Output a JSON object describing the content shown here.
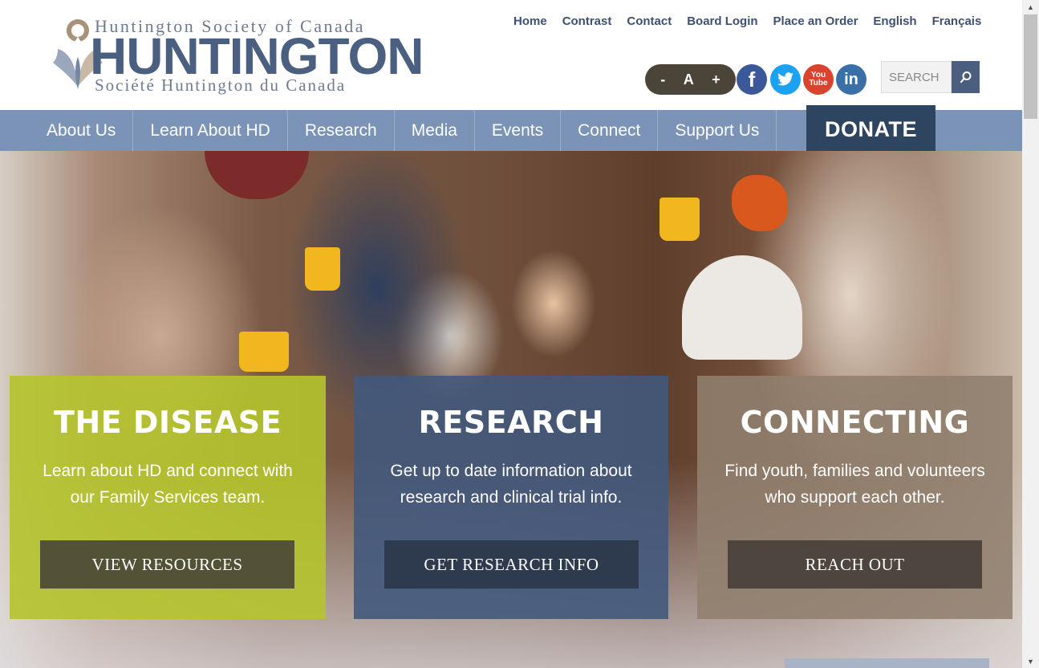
{
  "logo": {
    "top_line": "Huntington Society of Canada",
    "main": "HUNTINGTON",
    "bottom_line": "Société Huntington du Canada"
  },
  "toplinks": [
    "Home",
    "Contrast",
    "Contact",
    "Board Login",
    "Place an Order",
    "English",
    "Français"
  ],
  "font_sizer": {
    "decrease": "-",
    "reset": "A",
    "increase": "+"
  },
  "social": {
    "facebook": "f",
    "twitter": "t",
    "youtube_top": "You",
    "youtube_bottom": "Tube",
    "linkedin": "in"
  },
  "search": {
    "placeholder": "SEARCH"
  },
  "nav": [
    "About Us",
    "Learn About HD",
    "Research",
    "Media",
    "Events",
    "Connect",
    "Support Us"
  ],
  "donate": "DONATE",
  "cards": [
    {
      "title": "THE DISEASE",
      "text": "Learn about HD and connect with our Family Services team.",
      "button": "VIEW RESOURCES",
      "color": "#b5c42c"
    },
    {
      "title": "RESEARCH",
      "text": "Get up to date information about research and clinical trial info.",
      "button": "GET RESEARCH INFO",
      "color": "#42597d"
    },
    {
      "title": "CONNECTING",
      "text": "Find youth, families and volunteers who support each other.",
      "button": "REACH OUT",
      "color": "#91806e"
    }
  ],
  "colors": {
    "brand_blue": "#4b5f80",
    "nav_bg": "#7b93b6",
    "donate_bg": "#2d4560"
  },
  "icons": [
    "logo-mark-icon",
    "search-icon",
    "facebook-icon",
    "twitter-icon",
    "youtube-icon",
    "linkedin-icon"
  ]
}
